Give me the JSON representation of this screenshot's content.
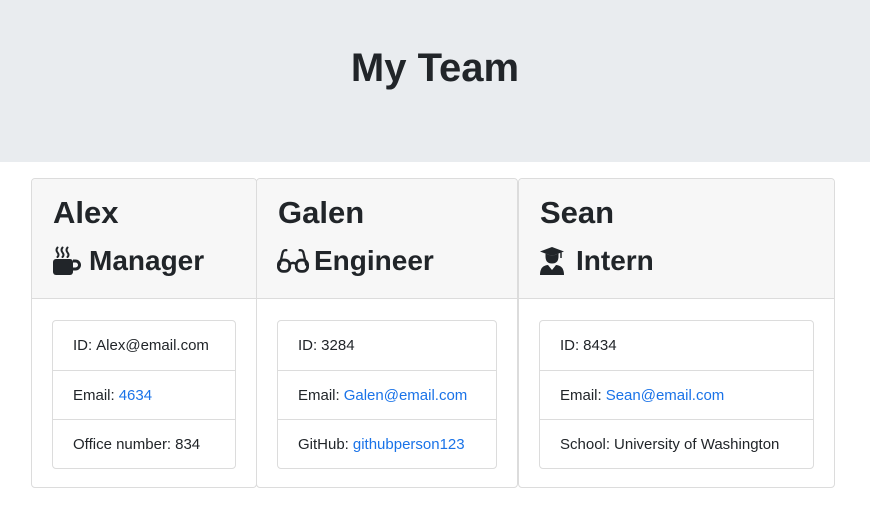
{
  "header": {
    "title": "My Team"
  },
  "colors": {
    "header_bg": "#e9ecef",
    "card_header_bg": "#f7f7f7",
    "link": "#1a73e8",
    "text": "#212529"
  },
  "cards": [
    {
      "name": "Alex",
      "role": "Manager",
      "icon": "coffee-mug-icon",
      "items": [
        {
          "label": "ID:",
          "value": "Alex@email.com"
        },
        {
          "label": "Email:",
          "value": "4634"
        },
        {
          "label": "Office number:",
          "value": "834"
        }
      ]
    },
    {
      "name": "Galen",
      "role": "Engineer",
      "icon": "glasses-icon",
      "items": [
        {
          "label": "ID:",
          "value": "3284"
        },
        {
          "label": "Email:",
          "value": "Galen@email.com"
        },
        {
          "label": "GitHub:",
          "value": "githubperson123"
        }
      ]
    },
    {
      "name": "Sean",
      "role": "Intern",
      "icon": "graduate-icon",
      "items": [
        {
          "label": "ID:",
          "value": "8434"
        },
        {
          "label": "Email:",
          "value": "Sean@email.com"
        },
        {
          "label": "School:",
          "value": "University of Washington"
        }
      ]
    }
  ]
}
